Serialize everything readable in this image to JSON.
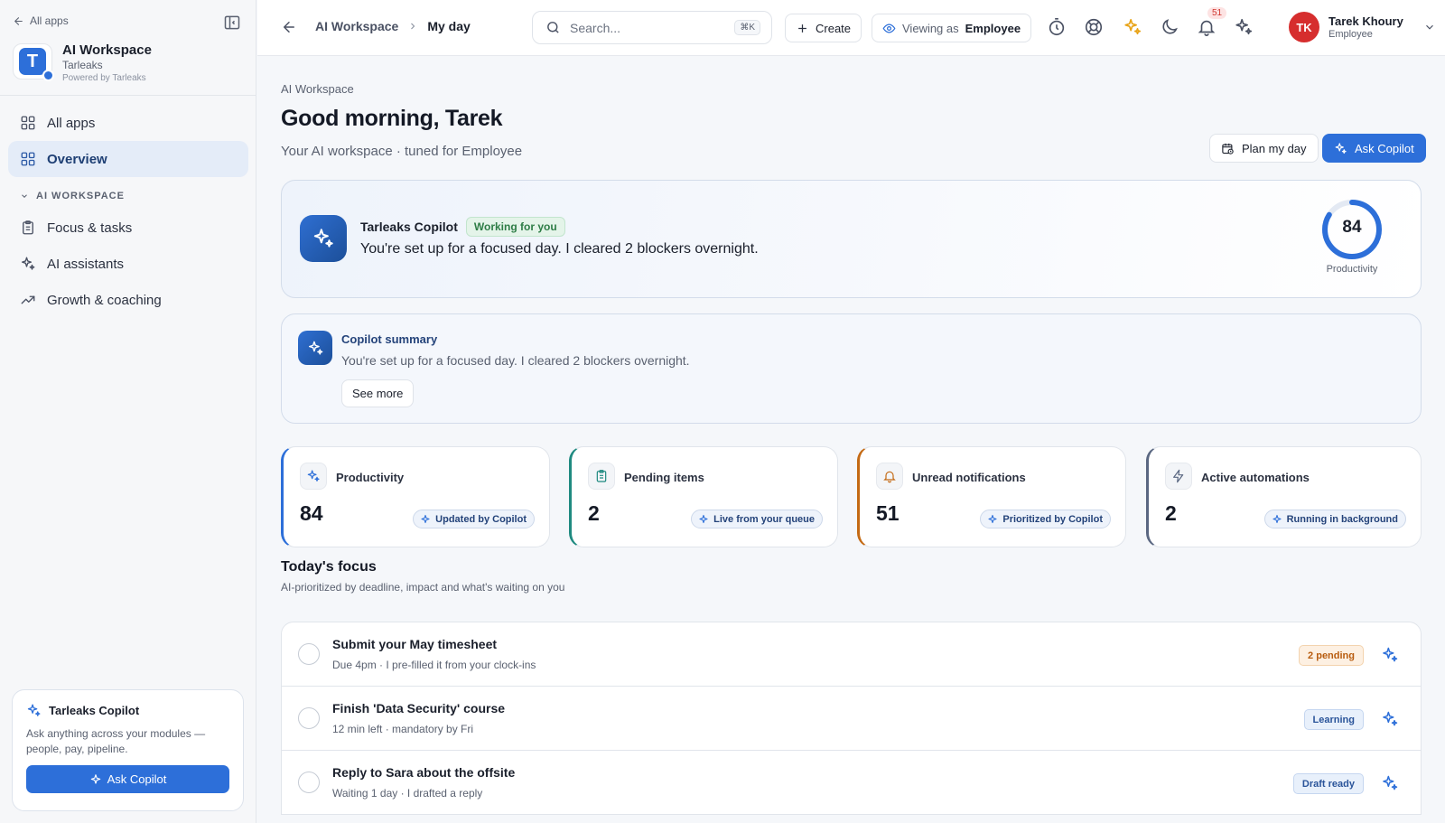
{
  "sidebar": {
    "back_label": "All apps",
    "app_name": "AI Workspace",
    "app_org": "Tarleaks",
    "app_powered": "Powered by Tarleaks",
    "app_logo_letter": "T",
    "nav_all_apps": "All apps",
    "nav_overview": "Overview",
    "section_label": "AI WORKSPACE",
    "nav_focus": "Focus & tasks",
    "nav_assistants": "AI assistants",
    "nav_growth": "Growth & coaching",
    "copilot_title": "Tarleaks Copilot",
    "copilot_desc": "Ask anything across your modules — people, pay, pipeline.",
    "copilot_btn": "Ask Copilot"
  },
  "topbar": {
    "crumb_1": "AI Workspace",
    "crumb_2": "My day",
    "search_placeholder": "Search...",
    "search_shortcut": "⌘K",
    "create_label": "Create",
    "viewing_label": "Viewing as",
    "viewing_value": "Employee",
    "notification_count": "51",
    "user_initials": "TK",
    "user_name": "Tarek Khoury",
    "user_role": "Employee"
  },
  "main": {
    "eyebrow": "AI Workspace",
    "greeting": "Good morning, Tarek",
    "subtitle": "Your AI workspace · tuned for Employee",
    "plan_label": "Plan my day",
    "ask_label": "Ask Copilot",
    "hero": {
      "name": "Tarleaks Copilot",
      "status": "Working for you",
      "message": "You're set up for a focused day. I cleared 2 blockers overnight.",
      "score": "84",
      "score_fraction": 0.84,
      "score_label": "Productivity"
    },
    "summary": {
      "title": "Copilot summary",
      "text": "You're set up for a focused day. I cleared 2 blockers overnight.",
      "button": "See more"
    },
    "stats": [
      {
        "label": "Productivity",
        "value": "84",
        "tag": "Updated by Copilot",
        "accent": "#2d6fd9"
      },
      {
        "label": "Pending items",
        "value": "2",
        "tag": "Live from your queue",
        "accent": "#1f8a80"
      },
      {
        "label": "Unread notifications",
        "value": "51",
        "tag": "Prioritized by Copilot",
        "accent": "#c46a14"
      },
      {
        "label": "Active automations",
        "value": "2",
        "tag": "Running in background",
        "accent": "#5a6781"
      }
    ],
    "focus_title": "Today's focus",
    "focus_sub": "AI-prioritized by deadline, impact and what's waiting on you",
    "tasks": [
      {
        "title": "Submit your May timesheet",
        "meta": "Due 4pm · I pre-filled it from your clock-ins",
        "tag": "2 pending"
      },
      {
        "title": "Finish 'Data Security' course",
        "meta": "12 min left · mandatory by Fri",
        "tag": "Learning"
      },
      {
        "title": "Reply to Sara about the offsite",
        "meta": "Waiting 1 day · I drafted a reply",
        "tag": "Draft ready"
      }
    ]
  },
  "colors": {
    "primary": "#2d6fd9",
    "success": "#2e7d46",
    "warning": "#b85c0f",
    "danger": "#d62e2e"
  }
}
